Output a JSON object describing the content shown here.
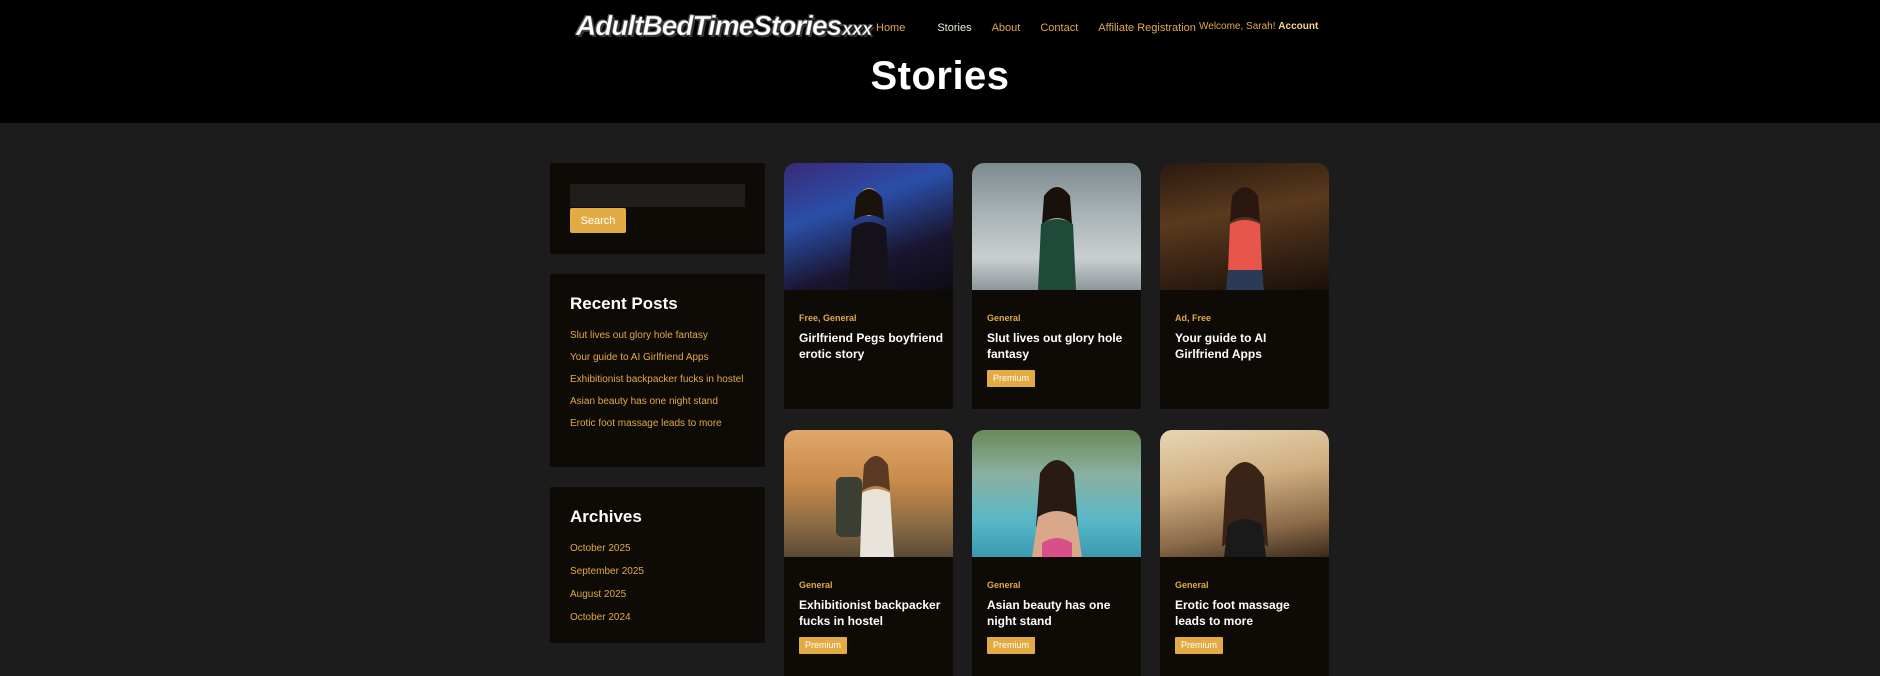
{
  "logo": {
    "text": "AdultBedTimeStories",
    "suffix": "xxx"
  },
  "nav": {
    "items": [
      "Home",
      "Stories",
      "About",
      "Contact",
      "Affiliate Registration"
    ],
    "welcome": "Welcome, Sarah!",
    "account": "Account"
  },
  "page": {
    "title": "Stories"
  },
  "search": {
    "placeholder": "",
    "button_label": "Search"
  },
  "recent": {
    "heading": "Recent Posts",
    "items": [
      "Slut lives out glory hole fantasy",
      "Your guide to AI Girlfriend Apps",
      "Exhibitionist backpacker fucks in hostel",
      "Asian beauty has one night stand",
      "Erotic foot massage leads to more"
    ]
  },
  "archives": {
    "heading": "Archives",
    "items": [
      "October 2025",
      "September 2025",
      "August 2025",
      "October 2024"
    ]
  },
  "stories": [
    {
      "categories": "Free, General",
      "title": "Girlfriend Pegs boyfriend erotic story",
      "badge": ""
    },
    {
      "categories": "General",
      "title": "Slut lives out glory hole fantasy",
      "badge": "Premium"
    },
    {
      "categories": "Ad, Free",
      "title": "Your guide to AI Girlfriend Apps",
      "badge": ""
    },
    {
      "categories": "General",
      "title": "Exhibitionist backpacker fucks in hostel",
      "badge": "Premium"
    },
    {
      "categories": "General",
      "title": "Asian beauty has one night stand",
      "badge": "Premium"
    },
    {
      "categories": "General",
      "title": "Erotic foot massage leads to more",
      "badge": "Premium"
    }
  ],
  "colors": {
    "header_bg": "#000000",
    "page_bg": "#1c1c1c",
    "widget_bg": "#0e0b07",
    "accent": "#e3ab44",
    "link": "#e0a94a"
  }
}
